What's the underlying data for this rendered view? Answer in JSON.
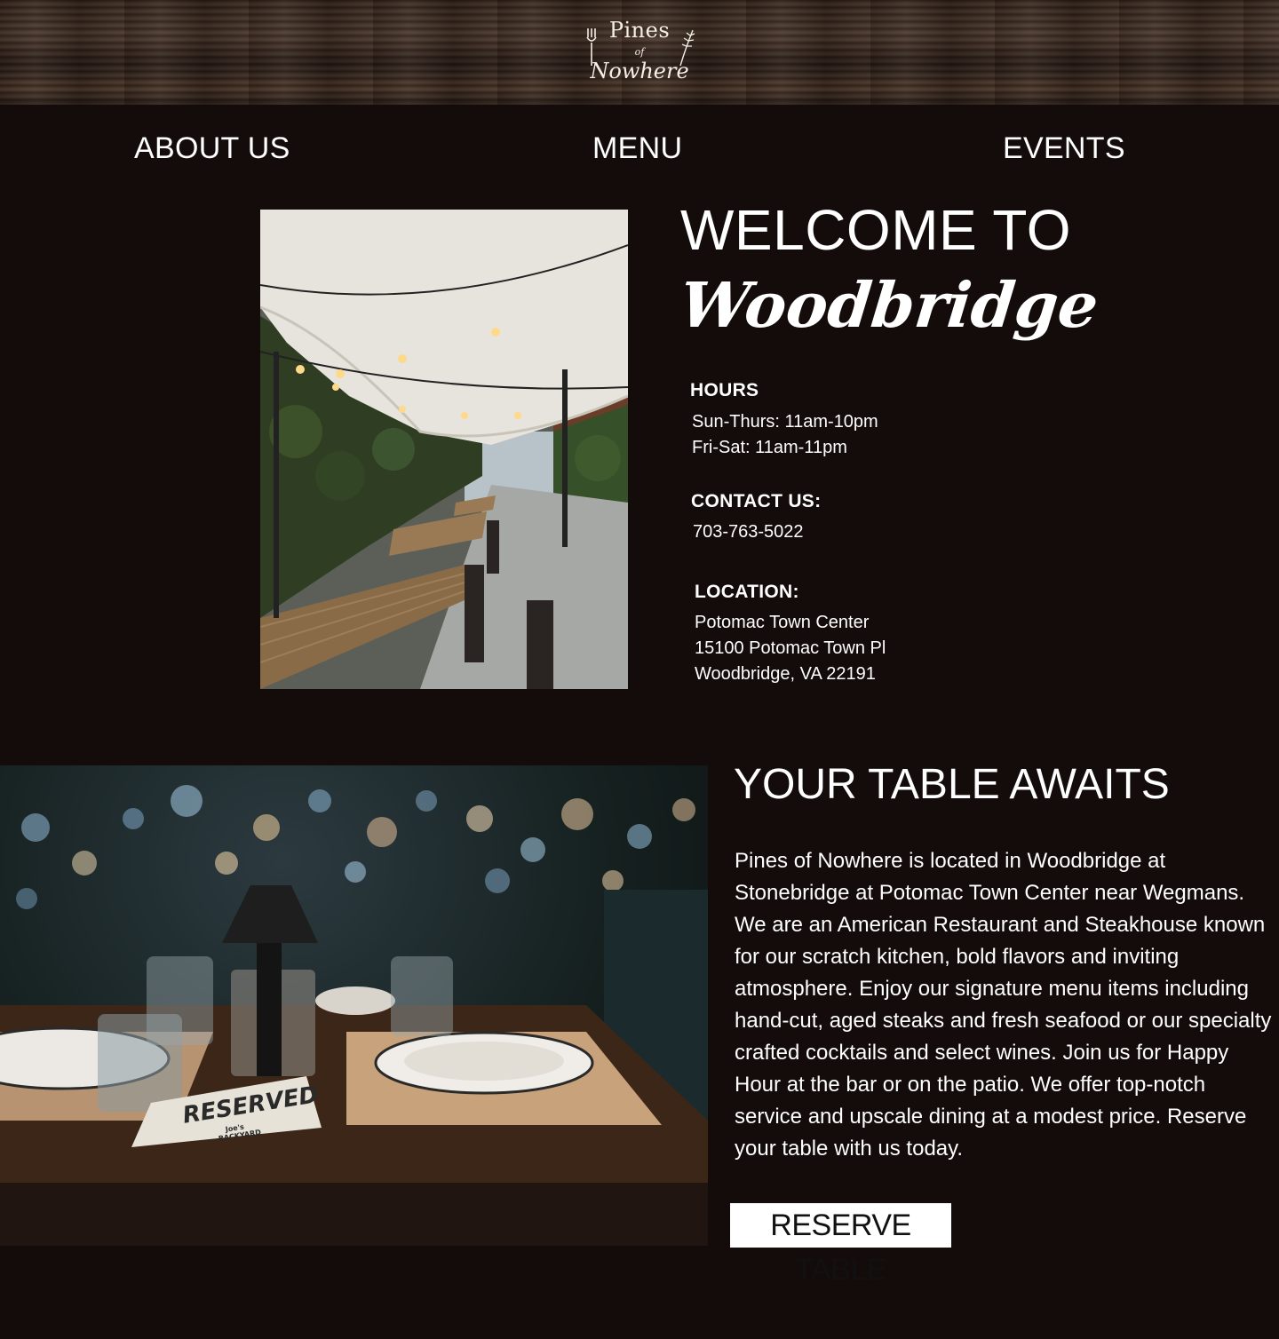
{
  "header": {
    "logo_line1": "Pines",
    "logo_line2": "of",
    "logo_line3": "Nowhere",
    "logo_icons": [
      "fork-icon",
      "wheat-icon"
    ]
  },
  "nav": {
    "about": "ABOUT US",
    "menu": "MENU",
    "events": "EVENTS"
  },
  "welcome": {
    "line1": "WELCOME TO",
    "line2": "Woodbridge"
  },
  "hours": {
    "heading": "HOURS",
    "line1": "Sun-Thurs: 11am-10pm",
    "line2": "Fri-Sat: 11am-11pm"
  },
  "contact": {
    "heading": "CONTACT US:",
    "phone": "703-763-5022"
  },
  "location": {
    "heading": "LOCATION:",
    "line1": "Potomac Town Center",
    "line2": "15100 Potomac Town Pl",
    "line3": "Woodbridge, VA 22191"
  },
  "table_section": {
    "heading": "YOUR TABLE AWAITS",
    "body": "Pines of Nowhere is located in Woodbridge at Stonebridge at Potomac Town Center near Wegmans. We are an American Restaurant and Steakhouse known for our scratch kitchen, bold flavors and inviting atmosphere. Enjoy our signature menu items including hand-cut, aged steaks and fresh seafood or our specialty crafted cocktails and select wines. Join us for Happy Hour at the bar or on the patio. We offer top-notch service and upscale dining at a modest price. Reserve your table with us today.",
    "button": "RESERVE TABLE",
    "photo_card_text": "RESERVED",
    "photo_card_subtext": "Joe's BACKYARD"
  },
  "colors": {
    "background": "#140c0a",
    "text": "#ffffff",
    "button_bg": "#ffffff",
    "button_text": "#111111"
  }
}
